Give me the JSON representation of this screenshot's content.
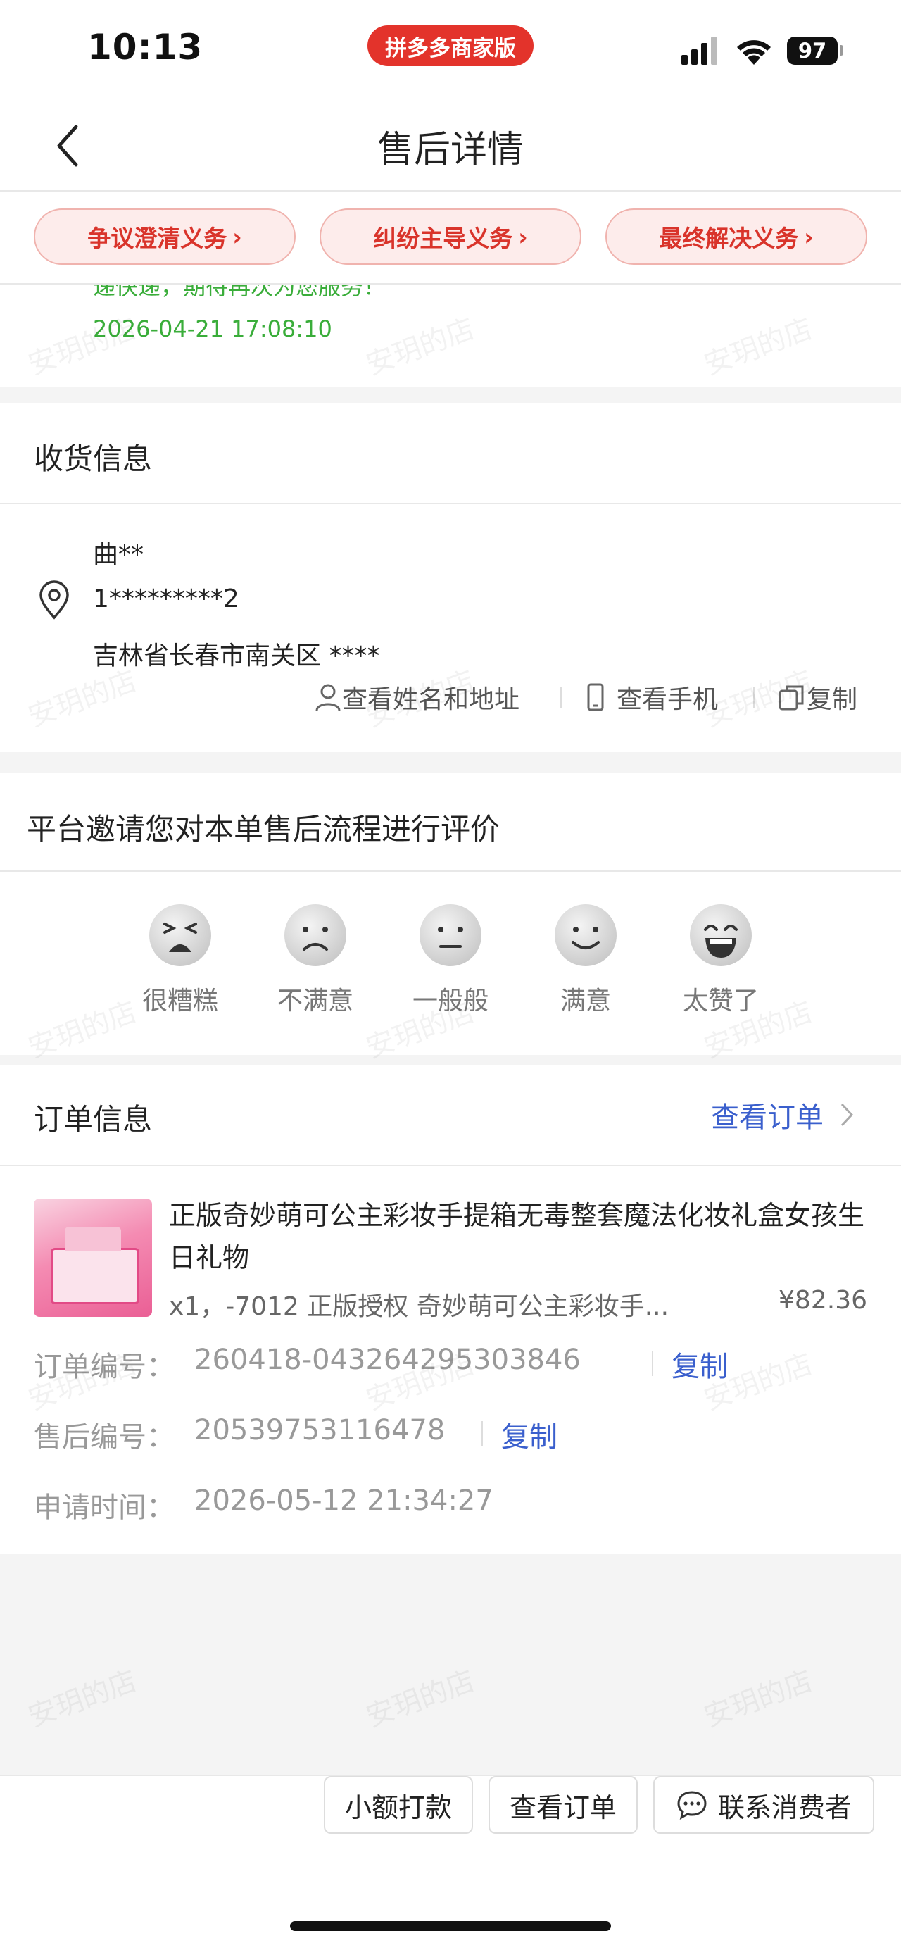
{
  "status_bar": {
    "time": "10:13",
    "store_label": "拼多多商家版",
    "battery": "97"
  },
  "nav": {
    "title": "售后详情"
  },
  "duty_tabs": [
    {
      "label": "争议澄清义务"
    },
    {
      "label": "纠纷主导义务"
    },
    {
      "label": "最终解决义务"
    }
  ],
  "log": {
    "partial_text": "递快递，期待再次为您服务！",
    "timestamp": "2026-04-21 17:08:10"
  },
  "shipping": {
    "title": "收货信息",
    "name": "曲**",
    "phone": "1*********2",
    "address": "吉林省长春市南关区 ****",
    "view_address_label": "查看姓名和地址",
    "view_phone_label": "查看手机",
    "copy_label": "复制"
  },
  "rating": {
    "title": "平台邀请您对本单售后流程进行评价",
    "options": [
      {
        "label": "很糟糕",
        "icon": "very-bad-face-icon"
      },
      {
        "label": "不满意",
        "icon": "unhappy-face-icon"
      },
      {
        "label": "一般般",
        "icon": "neutral-face-icon"
      },
      {
        "label": "满意",
        "icon": "happy-face-icon"
      },
      {
        "label": "太赞了",
        "icon": "great-face-icon"
      }
    ]
  },
  "order": {
    "title": "订单信息",
    "view_order_label": "查看订单",
    "product_title": "正版奇妙萌可公主彩妆手提箱无毒整套魔法化妆礼盒女孩生日礼物",
    "spec": "x1，-7012 正版授权 奇妙萌可公主彩妆手...",
    "price": "¥82.36",
    "order_no_label": "订单编号：",
    "order_no": "260418-043264295303846",
    "aftersale_no_label": "售后编号：",
    "aftersale_no": "20539753116478",
    "apply_time_label": "申请时间：",
    "apply_time": "2026-05-12 21:34:27",
    "copy_label": "复制"
  },
  "bottom_bar": {
    "small_payment_label": "小额打款",
    "view_order_label": "查看订单",
    "contact_label": "联系消费者"
  },
  "watermark": "安玥的店",
  "colors": {
    "brand_red": "#e3332b",
    "link_blue": "#3a5fcd",
    "log_green": "#3aad3a"
  }
}
